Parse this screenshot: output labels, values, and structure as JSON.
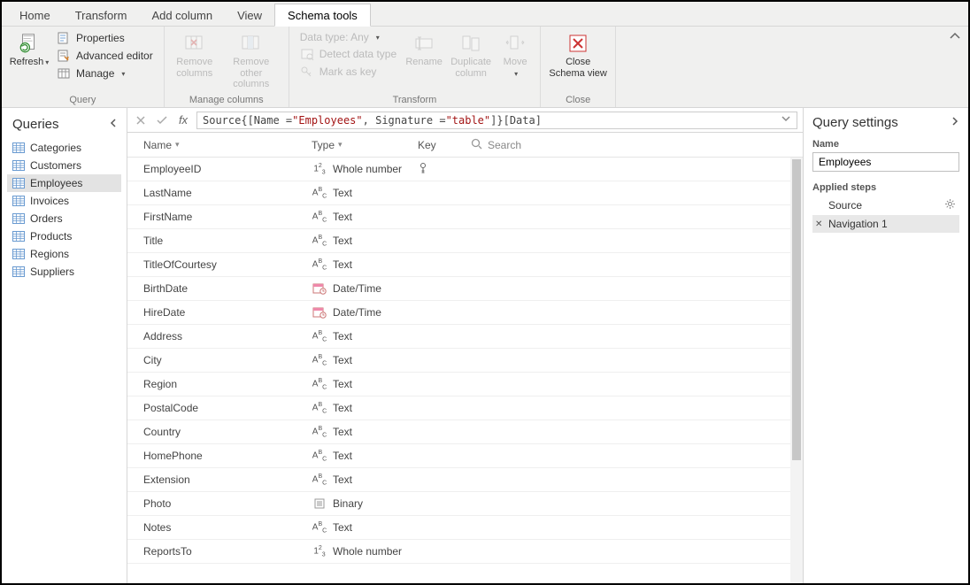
{
  "tabs": {
    "items": [
      "Home",
      "Transform",
      "Add column",
      "View",
      "Schema tools"
    ],
    "active_index": 4
  },
  "ribbon": {
    "query": {
      "label": "Query",
      "refresh": "Refresh",
      "properties": "Properties",
      "advanced_editor": "Advanced editor",
      "manage": "Manage"
    },
    "manage_columns": {
      "label": "Manage columns",
      "remove_columns": "Remove columns",
      "remove_other_columns": "Remove other columns"
    },
    "transform": {
      "label": "Transform",
      "data_type": "Data type: Any",
      "detect_data_type": "Detect data type",
      "mark_as_key": "Mark as key",
      "rename": "Rename",
      "duplicate_column": "Duplicate column",
      "move": "Move"
    },
    "close": {
      "label": "Close",
      "close_schema_view": "Close Schema view"
    }
  },
  "queries_panel": {
    "title": "Queries",
    "items": [
      "Categories",
      "Customers",
      "Employees",
      "Invoices",
      "Orders",
      "Products",
      "Regions",
      "Suppliers"
    ],
    "selected_index": 2
  },
  "formula": {
    "prefix": "Source{[Name = ",
    "s1": "\"Employees\"",
    "mid": ", Signature = ",
    "s2": "\"table\"",
    "suffix": "]}[Data]"
  },
  "schema_grid": {
    "headers": {
      "name": "Name",
      "type": "Type",
      "key": "Key",
      "search": "Search"
    },
    "rows": [
      {
        "name": "EmployeeID",
        "type": "Whole number",
        "type_icon": "num",
        "is_key": true
      },
      {
        "name": "LastName",
        "type": "Text",
        "type_icon": "text",
        "is_key": false
      },
      {
        "name": "FirstName",
        "type": "Text",
        "type_icon": "text",
        "is_key": false
      },
      {
        "name": "Title",
        "type": "Text",
        "type_icon": "text",
        "is_key": false
      },
      {
        "name": "TitleOfCourtesy",
        "type": "Text",
        "type_icon": "text",
        "is_key": false
      },
      {
        "name": "BirthDate",
        "type": "Date/Time",
        "type_icon": "date",
        "is_key": false
      },
      {
        "name": "HireDate",
        "type": "Date/Time",
        "type_icon": "date",
        "is_key": false
      },
      {
        "name": "Address",
        "type": "Text",
        "type_icon": "text",
        "is_key": false
      },
      {
        "name": "City",
        "type": "Text",
        "type_icon": "text",
        "is_key": false
      },
      {
        "name": "Region",
        "type": "Text",
        "type_icon": "text",
        "is_key": false
      },
      {
        "name": "PostalCode",
        "type": "Text",
        "type_icon": "text",
        "is_key": false
      },
      {
        "name": "Country",
        "type": "Text",
        "type_icon": "text",
        "is_key": false
      },
      {
        "name": "HomePhone",
        "type": "Text",
        "type_icon": "text",
        "is_key": false
      },
      {
        "name": "Extension",
        "type": "Text",
        "type_icon": "text",
        "is_key": false
      },
      {
        "name": "Photo",
        "type": "Binary",
        "type_icon": "bin",
        "is_key": false
      },
      {
        "name": "Notes",
        "type": "Text",
        "type_icon": "text",
        "is_key": false
      },
      {
        "name": "ReportsTo",
        "type": "Whole number",
        "type_icon": "num",
        "is_key": false
      }
    ]
  },
  "query_settings": {
    "title": "Query settings",
    "name_label": "Name",
    "name_value": "Employees",
    "applied_steps_label": "Applied steps",
    "steps": [
      {
        "label": "Source",
        "has_gear": true,
        "selected": false
      },
      {
        "label": "Navigation 1",
        "has_gear": false,
        "selected": true
      }
    ]
  }
}
